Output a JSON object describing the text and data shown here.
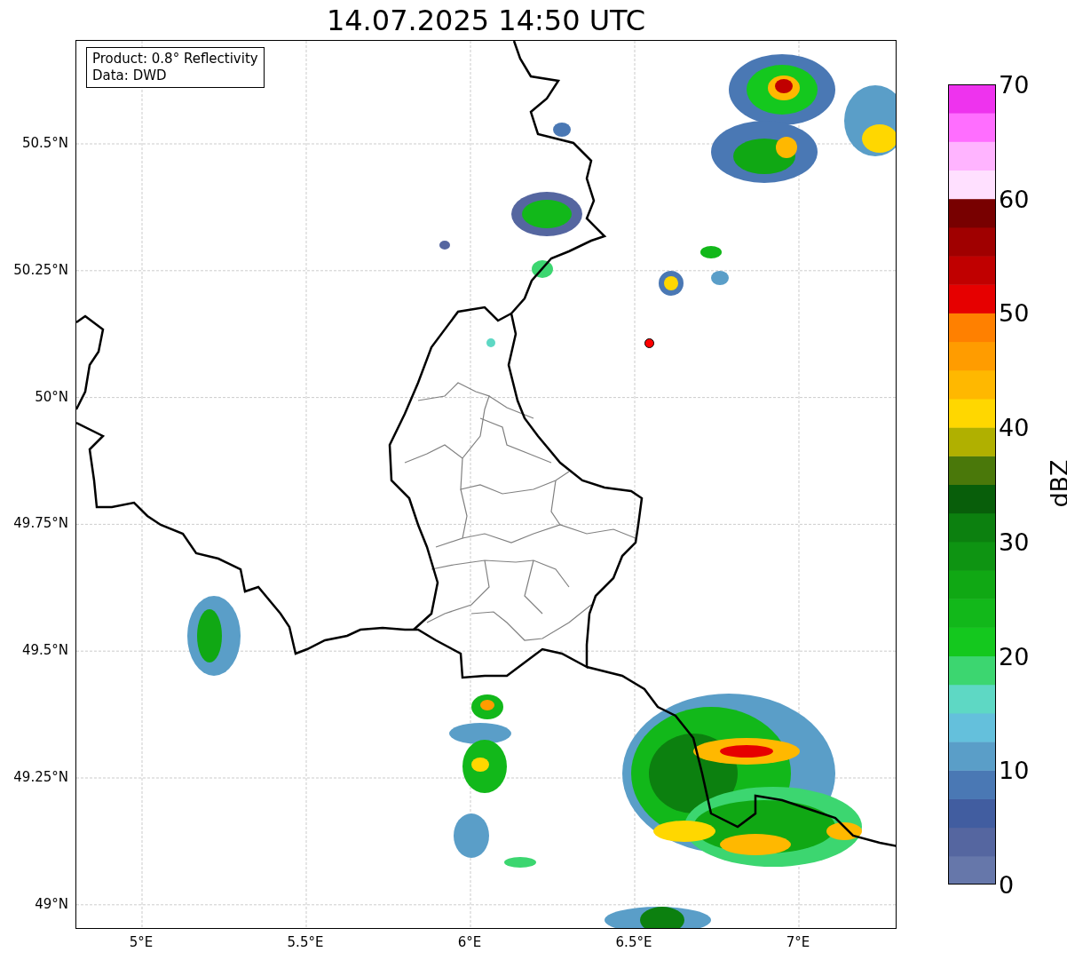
{
  "title": "14.07.2025 14:50 UTC",
  "info_box": {
    "lines": [
      "Product: 0.8° Reflectivity",
      "Data: DWD"
    ]
  },
  "map": {
    "lat_ticks": [
      "50.5°N",
      "50.25°N",
      "50°N",
      "49.75°N",
      "49.5°N",
      "49.25°N",
      "49°N"
    ],
    "lon_ticks": [
      "5°E",
      "5.5°E",
      "6°E",
      "6.5°E",
      "7°E"
    ]
  },
  "colorbar": {
    "label": "dBZ",
    "ticks": [
      "70",
      "60",
      "50",
      "40",
      "30",
      "20",
      "10",
      "0"
    ],
    "bins": [
      {
        "color": "#6677aa"
      },
      {
        "color": "#5566a0"
      },
      {
        "color": "#415da0"
      },
      {
        "color": "#4a78b4"
      },
      {
        "color": "#5a9ec8"
      },
      {
        "color": "#64c0dc"
      },
      {
        "color": "#5ed8c4"
      },
      {
        "color": "#3cd670"
      },
      {
        "color": "#14c81e"
      },
      {
        "color": "#12b81a"
      },
      {
        "color": "#10a814"
      },
      {
        "color": "#0e9412"
      },
      {
        "color": "#0c800f"
      },
      {
        "color": "#085e0a"
      },
      {
        "color": "#4a780a"
      },
      {
        "color": "#b0b000"
      },
      {
        "color": "#ffd700"
      },
      {
        "color": "#ffb800"
      },
      {
        "color": "#ff9c00"
      },
      {
        "color": "#ff8000"
      },
      {
        "color": "#e60000"
      },
      {
        "color": "#c00000"
      },
      {
        "color": "#a00000"
      },
      {
        "color": "#780000"
      },
      {
        "color": "#ffe0ff"
      },
      {
        "color": "#ffb4ff"
      },
      {
        "color": "#ff6eff"
      },
      {
        "color": "#ee33ee"
      }
    ]
  }
}
